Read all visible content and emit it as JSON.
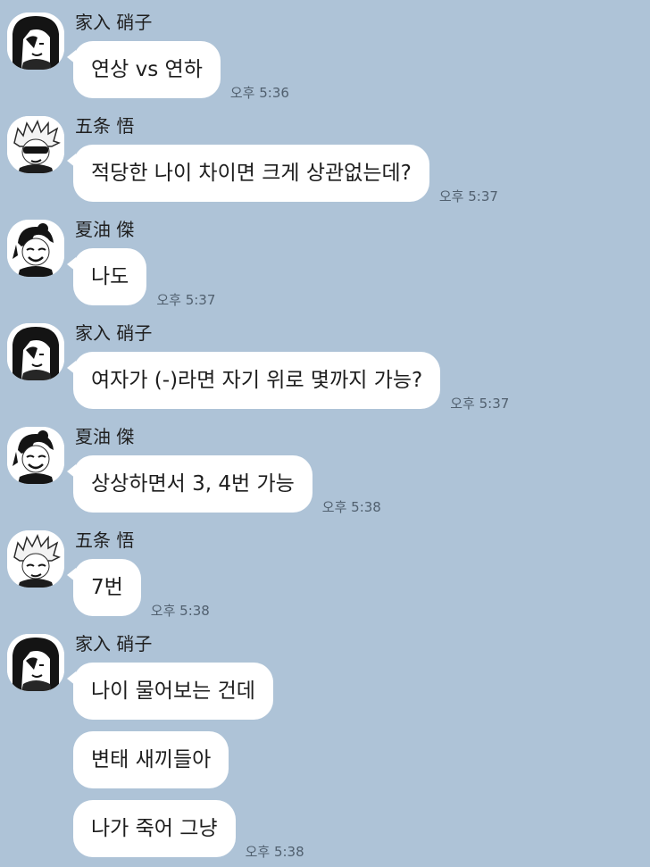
{
  "theme": {
    "background": "#aec3d7",
    "bubble": "#ffffff",
    "timestamp": "#51606f"
  },
  "messages": [
    {
      "sender": "家入 硝子",
      "avatar": "shoko-avatar",
      "lines": [
        "연상 vs 연하"
      ],
      "time": "오후 5:36"
    },
    {
      "sender": "五条 悟",
      "avatar": "gojo-avatar",
      "lines": [
        "적당한 나이 차이면 크게 상관없는데?"
      ],
      "time": "오후 5:37"
    },
    {
      "sender": "夏油 傑",
      "avatar": "geto-avatar",
      "lines": [
        "나도"
      ],
      "time": "오후 5:37"
    },
    {
      "sender": "家入 硝子",
      "avatar": "shoko-avatar",
      "lines": [
        "여자가 (-)라면 자기 위로 몇까지 가능?"
      ],
      "time": "오후 5:37"
    },
    {
      "sender": "夏油 傑",
      "avatar": "geto-avatar",
      "lines": [
        "상상하면서 3, 4번 가능"
      ],
      "time": "오후 5:38"
    },
    {
      "sender": "五条 悟",
      "avatar": "gojo-avatar",
      "lines": [
        "7번"
      ],
      "time": "오후 5:38"
    },
    {
      "sender": "家入 硝子",
      "avatar": "shoko-avatar",
      "lines": [
        "나이 물어보는 건데",
        "변태 새끼들아",
        "나가 죽어 그냥"
      ],
      "time": "오후 5:38"
    }
  ]
}
